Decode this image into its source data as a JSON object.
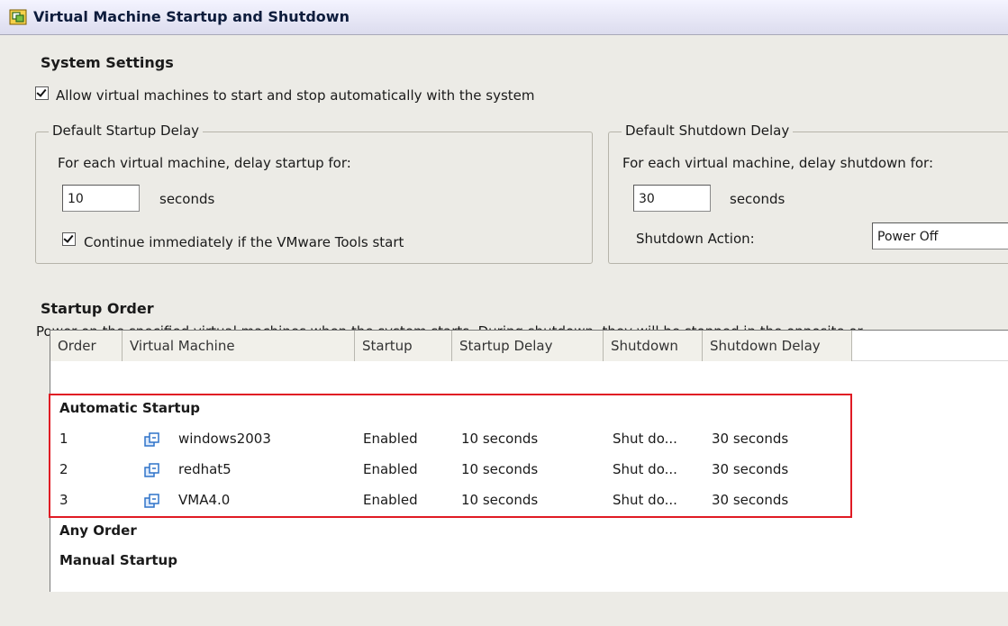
{
  "window": {
    "title": "Virtual Machine Startup and Shutdown",
    "title_icon": "vm-settings-icon"
  },
  "system_settings": {
    "heading": "System Settings",
    "allow_auto_label": "Allow virtual machines to start and stop automatically with the system",
    "allow_auto_checked": true
  },
  "startup_delay": {
    "legend": "Default Startup Delay",
    "description": "For each virtual machine, delay startup for:",
    "value": "10",
    "unit": "seconds",
    "continue_label": "Continue immediately if the VMware Tools start",
    "continue_checked": true
  },
  "shutdown_delay": {
    "legend": "Default Shutdown Delay",
    "description": "For each virtual machine, delay shutdown for:",
    "value": "30",
    "unit": "seconds",
    "action_label": "Shutdown Action:",
    "action_value": "Power Off"
  },
  "startup_order": {
    "heading": "Startup Order",
    "description": "Power on the specified virtual machines when the system starts. During shutdown, they will be stopped in the opposite or"
  },
  "table": {
    "columns": [
      "Order",
      "Virtual Machine",
      "Startup",
      "Startup Delay",
      "Shutdown",
      "Shutdown Delay"
    ],
    "groups": {
      "automatic": "Automatic Startup",
      "any": "Any Order",
      "manual": "Manual Startup"
    },
    "rows": [
      {
        "order": "1",
        "vm": "windows2003",
        "startup": "Enabled",
        "startup_delay": "10 seconds",
        "shutdown": "Shut do...",
        "shutdown_delay": "30 seconds"
      },
      {
        "order": "2",
        "vm": "redhat5",
        "startup": "Enabled",
        "startup_delay": "10 seconds",
        "shutdown": "Shut do...",
        "shutdown_delay": "30 seconds"
      },
      {
        "order": "3",
        "vm": "VMA4.0",
        "startup": "Enabled",
        "startup_delay": "10 seconds",
        "shutdown": "Shut do...",
        "shutdown_delay": "30 seconds"
      }
    ],
    "vm_icon": "virtual-machine-icon"
  },
  "colors": {
    "highlight": "#e01b24",
    "icon_blue": "#2f73c9"
  }
}
